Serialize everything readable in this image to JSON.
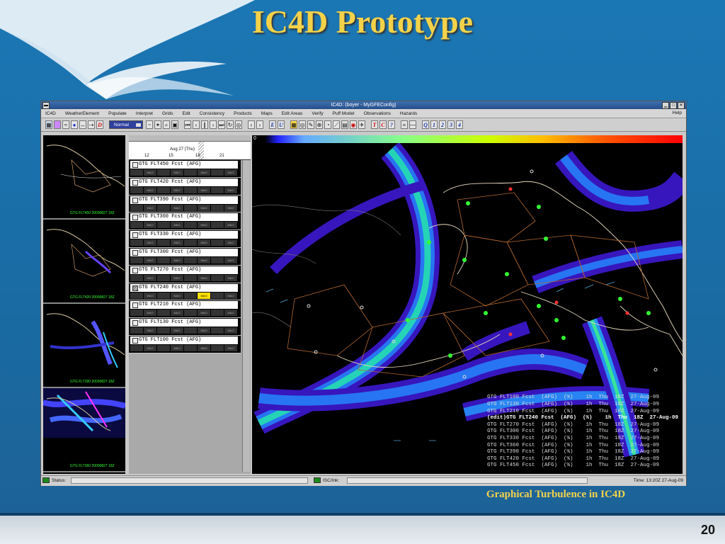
{
  "slide": {
    "title": "IC4D Prototype",
    "caption": "Graphical Turbulence in IC4D",
    "page_number": "20"
  },
  "window": {
    "title": "IC4D: (boyer - MyGFEConfig)",
    "menu": [
      "IC4D",
      "WeatherElement",
      "Populate",
      "Interpret",
      "Grids",
      "Edit",
      "Consistency",
      "Products",
      "Maps",
      "Edit Areas",
      "Verify",
      "Puff Model",
      "Observations",
      "Hazards"
    ],
    "help": "Help",
    "toolbar": {
      "mode": "Normal",
      "letters_a": [
        "D"
      ],
      "letters_b": [
        "E",
        "U"
      ],
      "letters_c": [
        "T",
        "C",
        "?"
      ],
      "letters_d": [
        "Q",
        "1",
        "2",
        "3",
        "4"
      ]
    }
  },
  "thumbnails": [
    {
      "label": "GTG FLT450 20090827 18Z"
    },
    {
      "label": "GTG FLT420 20090827 18Z"
    },
    {
      "label": "GTG FLT390 20090827 18Z"
    },
    {
      "label": "GTG FLT360 20090827 18Z"
    }
  ],
  "grid_manager": {
    "date": "Aug 27 (Thu)",
    "ticks": [
      "12",
      "15",
      "18",
      "21"
    ],
    "rows": [
      {
        "name": "GTG FLT450  Fcst (AFG)",
        "active": false
      },
      {
        "name": "GTG FLT420  Fcst (AFG)",
        "active": false
      },
      {
        "name": "GTG FLT390  Fcst (AFG)",
        "active": false
      },
      {
        "name": "GTG FLT360  Fcst (AFG)",
        "active": false
      },
      {
        "name": "GTG FLT330  Fcst (AFG)",
        "active": false
      },
      {
        "name": "GTG FLT300  Fcst (AFG)",
        "active": false
      },
      {
        "name": "GTG FLT270  Fcst (AFG)",
        "active": false
      },
      {
        "name": "GTG FLT240  Fcst (AFG)",
        "active": true
      },
      {
        "name": "GTG FLT210  Fcst (AFG)",
        "active": false
      },
      {
        "name": "GTG FLT130  Fcst (AFG)",
        "active": false
      },
      {
        "name": "GTG FLT100  Fcst (AFG)",
        "active": false
      }
    ],
    "block_label": "MAO"
  },
  "map": {
    "colorbar_min": "0",
    "legend": [
      {
        "text": "GTG FLT100 Fcst  (AFG)  (%)    1h  Thu  18Z  27-Aug-09",
        "edit": false
      },
      {
        "text": "GTG FLT130 Fcst  (AFG)  (%)    1h  Thu  18Z  27-Aug-09",
        "edit": false
      },
      {
        "text": "GTG FLT210 Fcst  (AFG)  (%)    1h  Thu  18Z  27-Aug-09",
        "edit": false
      },
      {
        "text": "(edit)GTG FLT240 Fcst  (AFG)  (%)    1h  Thu  18Z  27-Aug-09",
        "edit": true
      },
      {
        "text": "GTG FLT270 Fcst  (AFG)  (%)    1h  Thu  18Z  27-Aug-09",
        "edit": false
      },
      {
        "text": "GTG FLT300 Fcst  (AFG)  (%)    1h  Thu  18Z  27-Aug-09",
        "edit": false
      },
      {
        "text": "GTG FLT330 Fcst  (AFG)  (%)    1h  Thu  18Z  27-Aug-09",
        "edit": false
      },
      {
        "text": "GTG FLT360 Fcst  (AFG)  (%)    1h  Thu  18Z  27-Aug-09",
        "edit": false
      },
      {
        "text": "GTG FLT390 Fcst  (AFG)  (%)    1h  Thu  18Z  27-Aug-09",
        "edit": false
      },
      {
        "text": "GTG FLT420 Fcst  (AFG)  (%)    1h  Thu  18Z  27-Aug-09",
        "edit": false
      },
      {
        "text": "GTG FLT450 Fcst  (AFG)  (%)    1h  Thu  18Z  27-Aug-09",
        "edit": false
      }
    ]
  },
  "status": {
    "status_label": "Status:",
    "isc_label": "ISC/Ink:",
    "time": "Time: 13:20Z 27-Aug-09"
  },
  "colors": {
    "title": "#f3d24a",
    "window_title_bar": "#2f5c9c",
    "status_led": "#1c8a1c",
    "active_block": "#ffe000"
  }
}
